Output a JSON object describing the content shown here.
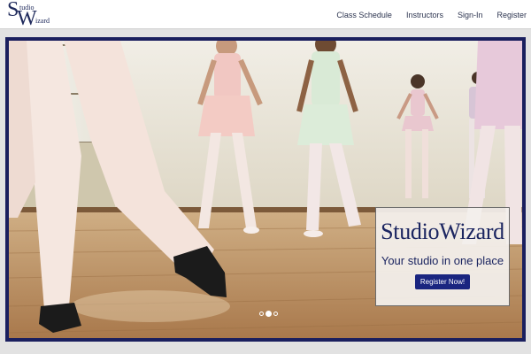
{
  "brand": {
    "letter_s": "S",
    "letter_w": "W",
    "small_top": "tudio",
    "small_bottom": "izard"
  },
  "nav": [
    {
      "label": "Class Schedule"
    },
    {
      "label": "Instructors"
    },
    {
      "label": "Sign-In"
    },
    {
      "label": "Register"
    }
  ],
  "hero": {
    "title": "StudioWizard",
    "tagline": "Your studio in one place",
    "cta_label": "Register Now!",
    "carousel": {
      "slides": 3,
      "active": 2
    }
  },
  "colors": {
    "brand": "#1f2a5c",
    "hero_border": "#1a1f5e",
    "cta_bg": "#1a2580"
  }
}
